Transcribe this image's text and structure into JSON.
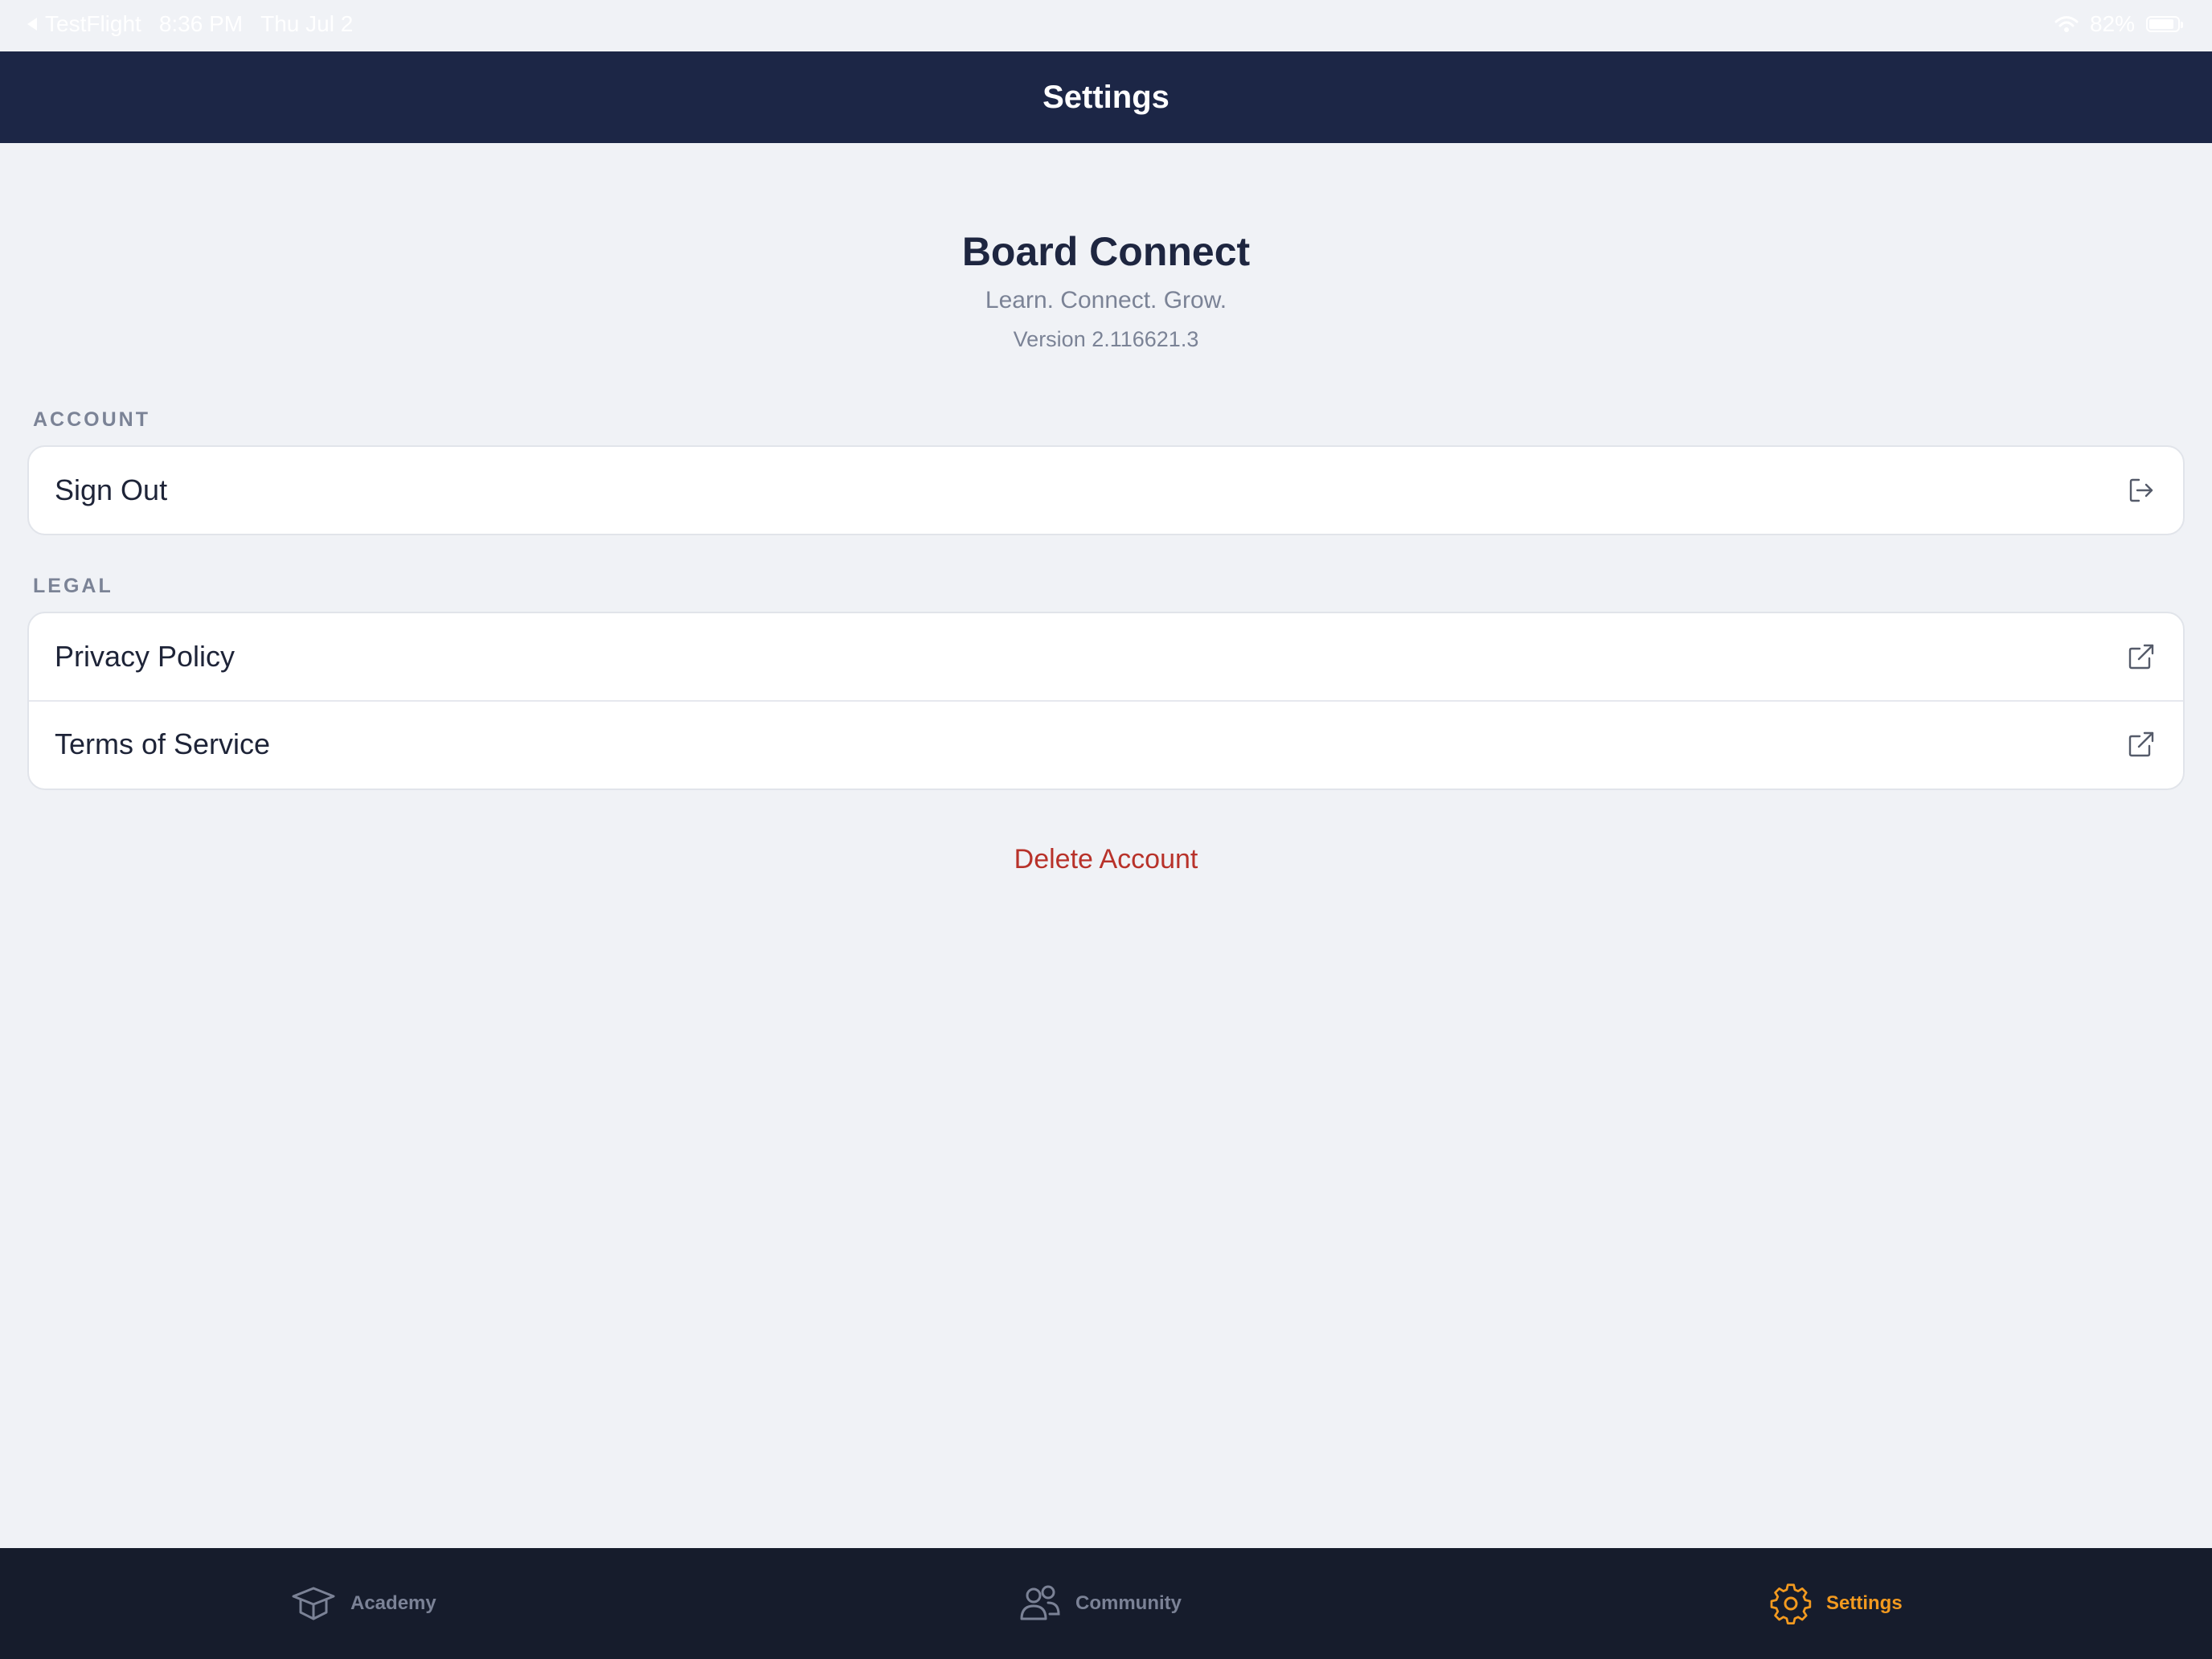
{
  "status_bar": {
    "back_app": "TestFlight",
    "time": "8:36 PM",
    "date": "Thu Jul 2",
    "battery": "82%"
  },
  "nav": {
    "title": "Settings"
  },
  "app": {
    "name": "Board Connect",
    "tagline": "Learn. Connect. Grow.",
    "version": "Version 2.116621.3"
  },
  "sections": {
    "account": {
      "header": "ACCOUNT",
      "sign_out": "Sign Out"
    },
    "legal": {
      "header": "LEGAL",
      "privacy_policy": "Privacy Policy",
      "terms_of_service": "Terms of Service"
    }
  },
  "delete_account": "Delete Account",
  "tabs": [
    {
      "label": "Academy",
      "icon": "graduation-cap-icon",
      "active": false
    },
    {
      "label": "Community",
      "icon": "users-icon",
      "active": false
    },
    {
      "label": "Settings",
      "icon": "gear-icon",
      "active": true
    }
  ],
  "colors": {
    "nav_background": "#1c2646",
    "tab_bar_background": "#161c2c",
    "active_tab": "#f39a1f",
    "destructive": "#b8322a",
    "page_background": "#f0f2f6"
  }
}
